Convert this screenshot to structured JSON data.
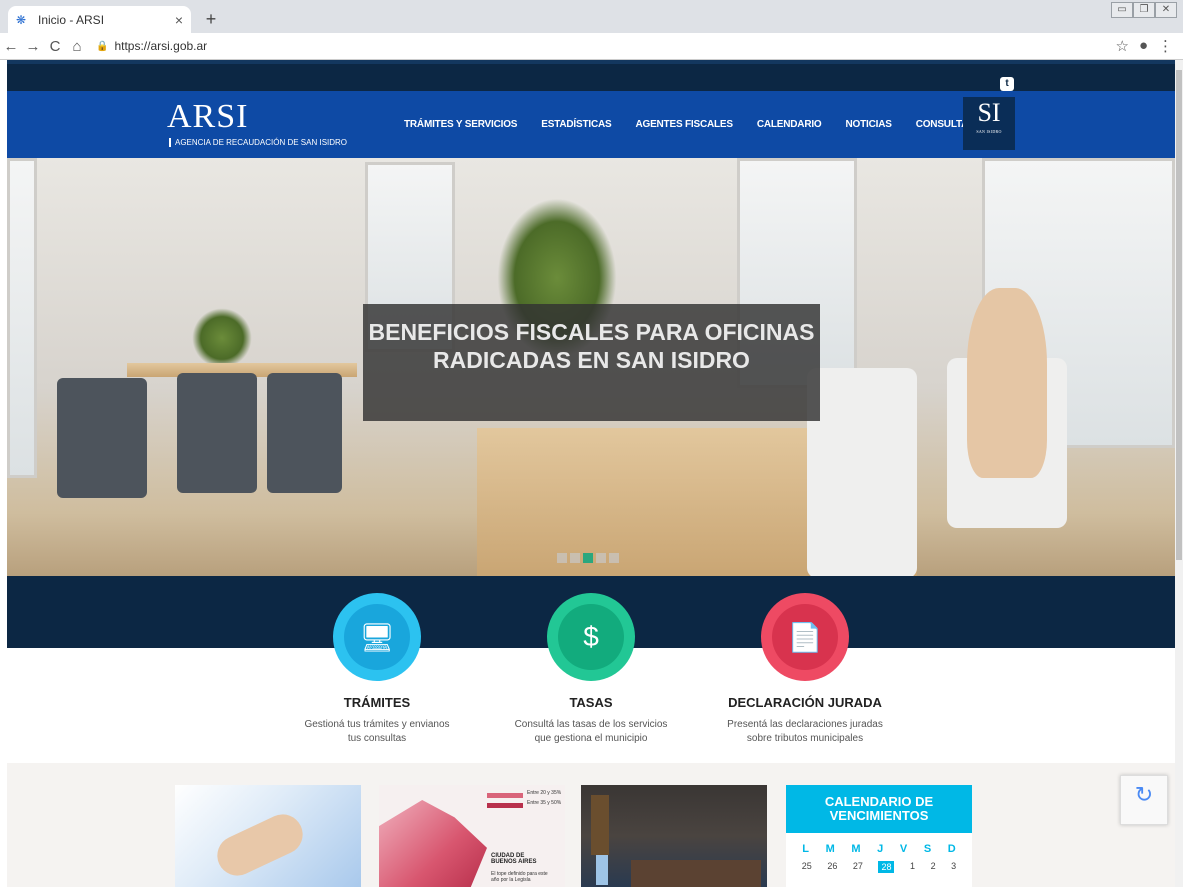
{
  "browser": {
    "tab_title": "Inicio - ARSI",
    "tab_close": "×",
    "new_tab": "+",
    "url": "https://arsi.gob.ar",
    "back": "←",
    "forward": "→",
    "reload": "C",
    "home": "⌂",
    "star": "☆",
    "account": "●",
    "menu": "⋮"
  },
  "header": {
    "logo": "ARSI",
    "logo_sub": "AGENCIA DE RECAUDACIÓN DE SAN ISIDRO",
    "menu": [
      "TRÁMITES Y SERVICIOS",
      "ESTADÍSTICAS",
      "AGENTES FISCALES",
      "CALENDARIO",
      "NOTICIAS",
      "CONSULTAS"
    ],
    "si_logo": "SI",
    "si_logo_sub": "SAN ISIDRO"
  },
  "hero": {
    "caption": "BENEFICIOS FISCALES PARA OFICINAS RADICADAS EN SAN ISIDRO",
    "slides": 5,
    "active_slide": 3
  },
  "services": [
    {
      "name": "TRÁMITES",
      "desc_1": "Gestioná tus trámites y envianos",
      "desc_2": "tus consultas",
      "color": "#1fb6ea",
      "inner": "#16a3d8",
      "icon": "🖥"
    },
    {
      "name": "TASAS",
      "desc_1": "Consultá las tasas de los servicios",
      "desc_2": "que gestiona el municipio",
      "color": "#1bbf8c",
      "inner": "#12a97a",
      "icon": "$"
    },
    {
      "name": "DECLARACIÓN JURADA",
      "desc_1": "Presentá las declaraciones juradas",
      "desc_2": "sobre tributos municipales",
      "color": "#e9425c",
      "inner": "#d8324d",
      "icon": "📄"
    }
  ],
  "calendar": {
    "title_1": "CALENDARIO DE",
    "title_2": "VENCIMIENTOS",
    "days": [
      "L",
      "M",
      "M",
      "J",
      "V",
      "S",
      "D"
    ],
    "nums": [
      "25",
      "26",
      "27",
      "28",
      "1",
      "2",
      "3"
    ],
    "today_index": 3
  },
  "map_legend": [
    "Entre 20 y 35%",
    "Entre 35 y 50%"
  ],
  "map_title": "CIUDAD DE BUENOS AIRES",
  "map_note": "El tope definido para este año por la Legisla"
}
